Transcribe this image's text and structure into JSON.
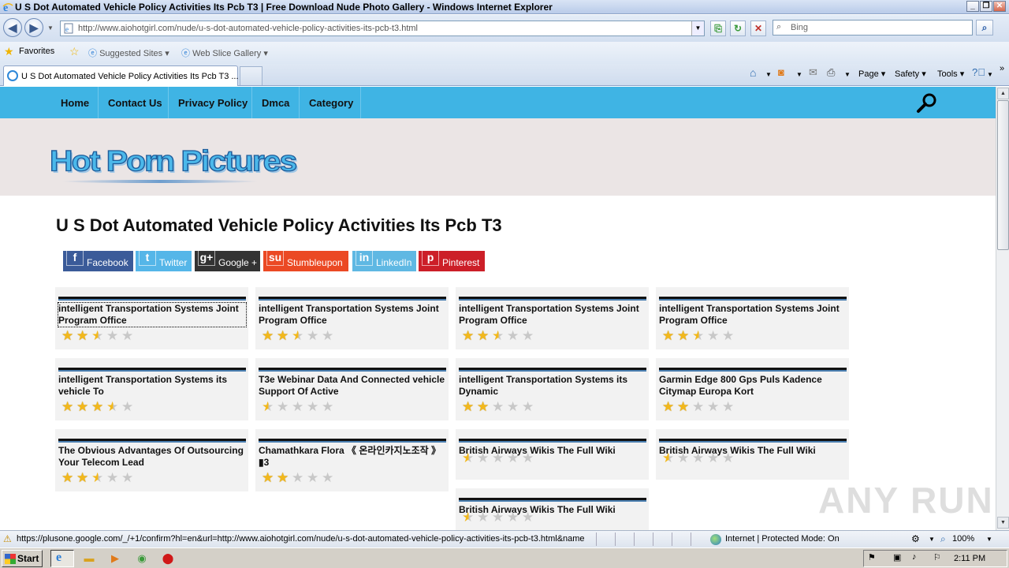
{
  "window": {
    "title": "U S Dot Automated Vehicle Policy Activities Its Pcb T3 | Free Download Nude Photo Gallery - Windows Internet Explorer"
  },
  "addressbar": {
    "url": "http://www.aiohotgirl.com/nude/u-s-dot-automated-vehicle-policy-activities-its-pcb-t3.html",
    "search_placeholder": "Bing"
  },
  "favorites": {
    "favorites_label": "Favorites",
    "suggested_label": "Suggested Sites",
    "webslice_label": "Web Slice Gallery"
  },
  "tabs": {
    "active_label": "U S Dot Automated Vehicle Policy Activities Its Pcb T3 ..."
  },
  "commandbar": {
    "page": "Page",
    "safety": "Safety",
    "tools": "Tools"
  },
  "site": {
    "nav": [
      "Home",
      "Contact Us",
      "Privacy Policy",
      "Dmca",
      "Category"
    ],
    "logo_text": "Hot Porn Pictures",
    "page_title": "U S Dot Automated Vehicle Policy Activities Its Pcb T3",
    "share": [
      {
        "label": "Facebook",
        "icon": "f",
        "color": "#3b5b99"
      },
      {
        "label": "Twitter",
        "icon": "t",
        "color": "#55b6e8"
      },
      {
        "label": "Google +",
        "icon": "g+",
        "color": "#333333"
      },
      {
        "label": "Stumbleupon",
        "icon": "su",
        "color": "#eb4924"
      },
      {
        "label": "LinkedIn",
        "icon": "in",
        "color": "#5fb8e3"
      },
      {
        "label": "Pinterest",
        "icon": "p",
        "color": "#cc1f28"
      }
    ],
    "cards": [
      {
        "title": "intelligent Transportation Systems Joint Program Office",
        "rating": 2.5
      },
      {
        "title": "intelligent Transportation Systems Joint Program Office",
        "rating": 2.5
      },
      {
        "title": "intelligent Transportation Systems Joint Program Office",
        "rating": 2.5
      },
      {
        "title": "intelligent Transportation Systems Joint Program Office",
        "rating": 2.5
      },
      {
        "title": "intelligent Transportation Systems its vehicle To",
        "rating": 3.5
      },
      {
        "title": "T3e Webinar Data And Connected vehicle Support Of Active",
        "rating": 0.5
      },
      {
        "title": "intelligent Transportation Systems its Dynamic",
        "rating": 2
      },
      {
        "title": "Garmin Edge 800 Gps Puls Kadence Citymap Europa Kort",
        "rating": 2
      },
      {
        "title": "The Obvious Advantages Of Outsourcing Your Telecom Lead",
        "rating": 2.5
      },
      {
        "title": "Chamathkara Flora 《 온라인카지노조작 》 ▮3",
        "rating": 2
      },
      {
        "title": "British Airways Wikis The Full Wiki",
        "rating": 0.5
      },
      {
        "title": "British Airways Wikis The Full Wiki",
        "rating": 0.5
      },
      {
        "title": "British Airways Wikis The Full Wiki",
        "rating": 0.5
      }
    ],
    "watermark": "ANY RUN"
  },
  "statusbar": {
    "link": "https://plusone.google.com/_/+1/confirm?hl=en&url=http://www.aiohotgirl.com/nude/u-s-dot-automated-vehicle-policy-activities-its-pcb-t3.html&name",
    "zone": "Internet | Protected Mode: On",
    "zoom": "100%"
  },
  "taskbar": {
    "start": "Start",
    "clock": "2:11 PM"
  },
  "colors": {
    "nav_bg": "#3fb4e4",
    "header_band": "#ebe5e5",
    "star": "#f2b81c"
  }
}
